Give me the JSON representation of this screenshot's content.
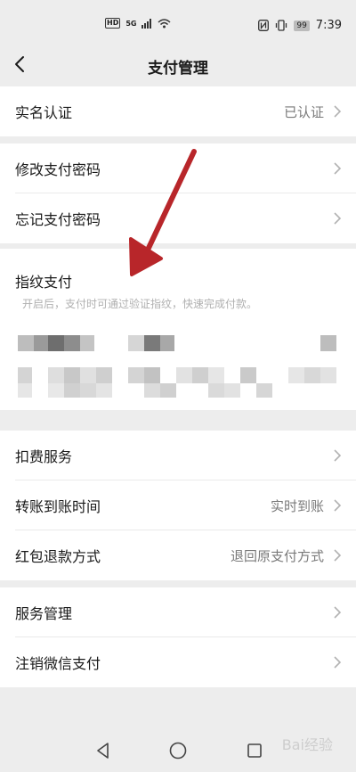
{
  "status_bar": {
    "hd": "HD",
    "network": "5G",
    "battery": "99",
    "time": "7:39"
  },
  "header": {
    "title": "支付管理"
  },
  "verification": {
    "label": "实名认证",
    "value": "已认证"
  },
  "password": {
    "change_label": "修改支付密码",
    "forgot_label": "忘记支付密码"
  },
  "fingerprint": {
    "label": "指纹支付",
    "description": "开启后，支付时可通过验证指纹，快速完成付款。"
  },
  "services": {
    "deduction_label": "扣费服务",
    "transfer_time_label": "转账到账时间",
    "transfer_time_value": "实时到账",
    "red_packet_refund_label": "红包退款方式",
    "red_packet_refund_value": "退回原支付方式"
  },
  "management": {
    "service_mgmt_label": "服务管理",
    "cancel_wechat_pay_label": "注销微信支付"
  },
  "watermark": "Bai经验",
  "colors": {
    "arrow": "#b8262a",
    "background": "#ededed"
  }
}
